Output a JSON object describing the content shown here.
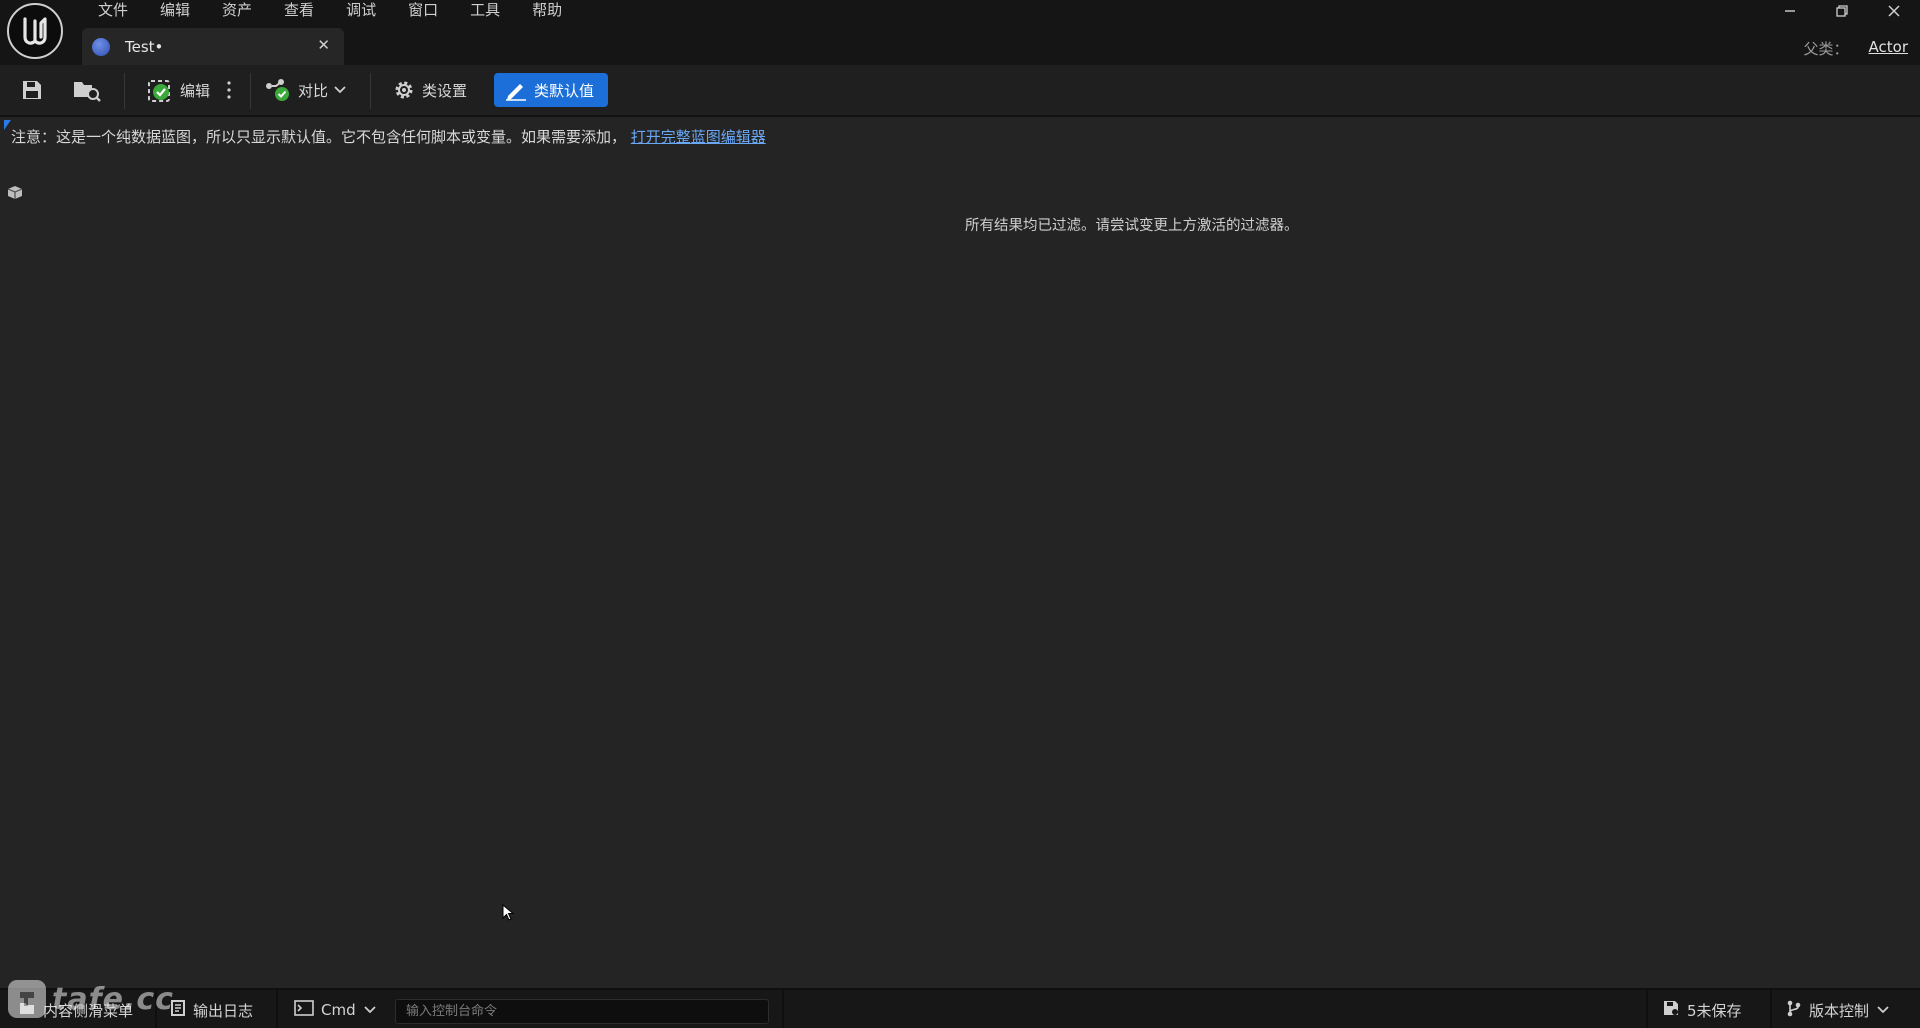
{
  "menu": [
    "文件",
    "编辑",
    "资产",
    "查看",
    "调试",
    "窗口",
    "工具",
    "帮助"
  ],
  "window_controls": [
    "minimize-icon",
    "restore-icon",
    "close-icon"
  ],
  "tab": {
    "label": "Test•",
    "icon": "blueprint-icon",
    "close_icon": "close-icon"
  },
  "parent_class": {
    "label": "父类：",
    "value": "Actor"
  },
  "toolbar": {
    "save_icon": "save-icon",
    "browse_icon": "browse-content-icon",
    "compile_label": "编辑",
    "compile_icon": "compile-success-icon",
    "diff_label": "对比",
    "diff_icon": "diff-icon",
    "class_settings_label": "类设置",
    "class_settings_icon": "gear-icon",
    "class_defaults_label": "类默认值",
    "class_defaults_icon": "pencil-icon",
    "accent": "#1c6fd8"
  },
  "notice": {
    "text": "注意：这是一个纯数据蓝图，所以只显示默认值。它不包含任何脚本或变量。如果需要添加，",
    "link": "打开完整蓝图编辑器"
  },
  "details": {
    "empty_message": "所有结果均已过滤。请尝试变更上方激活的过滤器。",
    "icon": "object-icon"
  },
  "statusbar": {
    "content_drawer": "内容侧滑菜单",
    "output_log": "输出日志",
    "cmd": "Cmd",
    "cmd_placeholder": "输入控制台命令",
    "unsaved": "5未保存",
    "source_control": "版本控制"
  },
  "watermark": {
    "text": "tafe.cc"
  }
}
